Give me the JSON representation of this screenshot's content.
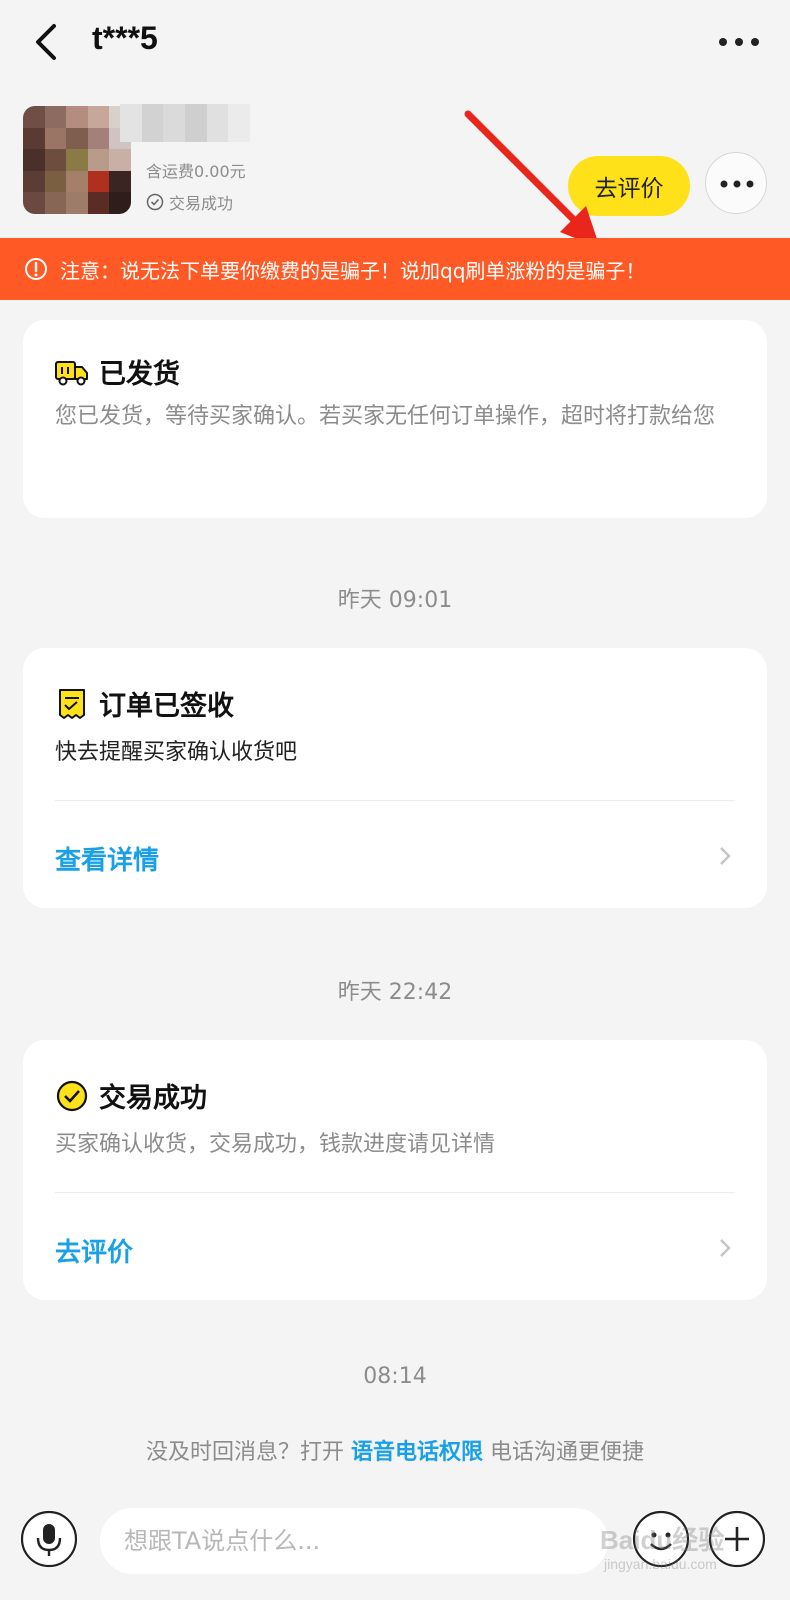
{
  "header": {
    "title": "t***5"
  },
  "order": {
    "freight": "含运费0.00元",
    "status": "交易成功",
    "review_button": "去评价"
  },
  "banner": {
    "text": "注意：说无法下单要你缴费的是骗子！说加qq刷单涨粉的是骗子！"
  },
  "cards": [
    {
      "title": "已发货",
      "desc": "您已发货，等待买家确认。若买家无任何订单操作，超时将打款给您"
    },
    {
      "title": "订单已签收",
      "desc": "快去提醒买家确认收货吧",
      "link": "查看详情"
    },
    {
      "title": "交易成功",
      "desc": "买家确认收货，交易成功，钱款进度请见详情",
      "link": "去评价"
    }
  ],
  "times": [
    "昨天 09:01",
    "昨天 22:42",
    "08:14"
  ],
  "tip": {
    "before": "没及时回消息？打开 ",
    "link": "语音电话权限",
    "after": " 电话沟通更便捷"
  },
  "input": {
    "placeholder": "想跟TA说点什么..."
  },
  "watermark": {
    "text": "Baidu经验",
    "sub": "jingyan.baidu.com"
  },
  "colors": {
    "accent_yellow": "#ffe11a",
    "banner_orange": "#ff5a25",
    "link_blue": "#1aa0e6",
    "background": "#f4f4f5"
  },
  "icons": [
    "back-arrow-icon",
    "more-dots-icon",
    "check-circle-icon",
    "warning-icon",
    "truck-icon",
    "receipt-icon",
    "checkmark-icon",
    "chevron-right-icon",
    "microphone-icon",
    "emoji-icon",
    "plus-icon"
  ]
}
